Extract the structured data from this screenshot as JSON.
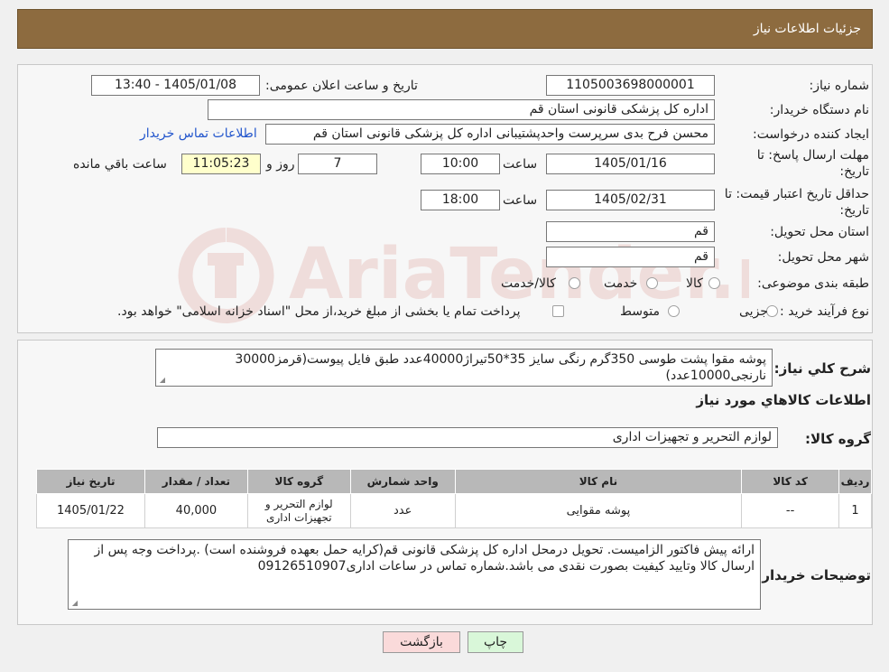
{
  "header": {
    "title": "جزئیات اطلاعات نیاز"
  },
  "form": {
    "need_number_label": "شماره نیاز:",
    "need_number": "1105003698000001",
    "announce_label": "تاریخ و ساعت اعلان عمومی:",
    "announce_value": "1405/01/08 - 13:40",
    "buyer_org_label": "نام دستگاه خریدار:",
    "buyer_org": "اداره کل پزشکی قانونی استان قم",
    "creator_label": "ایجاد کننده درخواست:",
    "creator": "محسن فرح بدی سرپرست واحدپشتیبانی اداره کل پزشکی قانونی استان قم",
    "contact_link": "اطلاعات تماس خریدار",
    "deadline_label_1": "مهلت ارسال پاسخ: تا",
    "deadline_label_2": "تاریخ:",
    "deadline_date": "1405/01/16",
    "time_label": "ساعت",
    "deadline_time": "10:00",
    "days_value": "7",
    "days_label": "روز و",
    "remaining_time": "11:05:23",
    "remaining_label": "ساعت باقي مانده",
    "validity_label_1": "حداقل تاریخ اعتبار قیمت: تا",
    "validity_label_2": "تاریخ:",
    "validity_date": "1405/02/31",
    "validity_time": "18:00",
    "province_label": "استان محل تحویل:",
    "province": "قم",
    "city_label": "شهر محل تحویل:",
    "city": "قم",
    "category_label": "طبقه بندی موضوعی:",
    "category_options": [
      "کالا",
      "خدمت",
      "کالا/خدمت"
    ],
    "process_label": "نوع فرآیند خرید :",
    "process_options": [
      "جزیی",
      "متوسط"
    ],
    "process_note": "پرداخت تمام یا بخشی از مبلغ خرید،از محل \"اسناد خزانه اسلامی\" خواهد بود."
  },
  "watermark": {
    "text": "AriaTender.neT"
  },
  "details": {
    "desc_label": "شرح کلي نياز:",
    "desc": "پوشه مقوا پشت طوسی 350گرم رنگی سایز 35*50تیراژ40000عدد طبق فایل پیوست(قرمز30000 نارنجی10000عدد)",
    "items_title": "اطلاعات کالاهاي مورد نياز",
    "group_label": "گروه کالا:",
    "group_value": "لوازم التحرير و تجهيزات اداری",
    "table": {
      "headers": [
        "ردیف",
        "کد کالا",
        "نام کالا",
        "واحد شمارش",
        "گروه کالا",
        "تعداد / مقدار",
        "تاریخ نیاز"
      ],
      "rows": [
        [
          "1",
          "--",
          "پوشه مقوایی",
          "عدد",
          "لوازم التحرير و تجهيزات اداری",
          "40,000",
          "1405/01/22"
        ]
      ]
    },
    "buyer_notes_label": "توضیحات خریدار:",
    "buyer_notes": "ارائه پیش فاکتور الزامیست. تحویل درمحل اداره کل پزشکی قانونی قم(کرایه حمل بعهده فروشنده است) .پرداخت وجه پس از ارسال کالا وتایید کیفیت بصورت نقدی می باشد.شماره تماس در ساعات اداری09126510907"
  },
  "buttons": {
    "print": "چاپ",
    "back": "بازگشت"
  },
  "colors": {
    "header_bg": "#8d6b3f",
    "print_bg": "#d9f7d9",
    "back_bg": "#fadada",
    "link": "#2255cc"
  }
}
